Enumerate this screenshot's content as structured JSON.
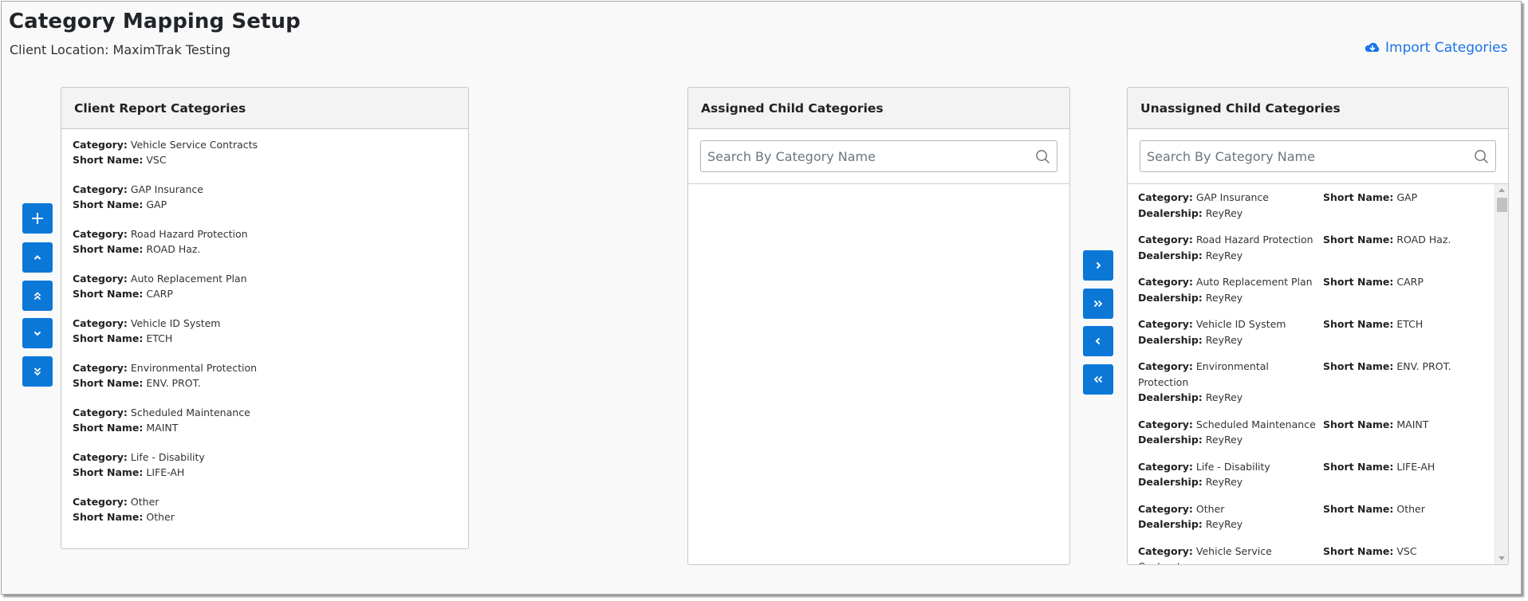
{
  "header": {
    "title": "Category Mapping Setup",
    "subtitle": "Client Location: MaximTrak Testing",
    "import_label": "Import Categories"
  },
  "labels": {
    "category": "Category:",
    "short_name": "Short Name:",
    "dealership": "Dealership:"
  },
  "client_report_categories": {
    "title": "Client Report Categories",
    "items": [
      {
        "category": "Vehicle Service Contracts",
        "short_name": "VSC"
      },
      {
        "category": "GAP Insurance",
        "short_name": "GAP"
      },
      {
        "category": "Road Hazard Protection",
        "short_name": "ROAD Haz."
      },
      {
        "category": "Auto Replacement Plan",
        "short_name": "CARP"
      },
      {
        "category": "Vehicle ID System",
        "short_name": "ETCH"
      },
      {
        "category": "Environmental Protection",
        "short_name": "ENV. PROT."
      },
      {
        "category": "Scheduled Maintenance",
        "short_name": "MAINT"
      },
      {
        "category": "Life - Disability",
        "short_name": "LIFE-AH"
      },
      {
        "category": "Other",
        "short_name": "Other"
      }
    ]
  },
  "order_buttons": [
    {
      "name": "add-category-button",
      "icon": "plus-icon"
    },
    {
      "name": "move-up-button",
      "icon": "chevron-up-icon"
    },
    {
      "name": "move-top-button",
      "icon": "double-chevron-up-icon"
    },
    {
      "name": "move-down-button",
      "icon": "chevron-down-icon"
    },
    {
      "name": "move-bottom-button",
      "icon": "double-chevron-down-icon"
    }
  ],
  "assigned_child_categories": {
    "title": "Assigned Child Categories",
    "search_placeholder": "Search By Category Name",
    "search_value": "",
    "items": []
  },
  "transfer_buttons": [
    {
      "name": "assign-selected-button",
      "icon": "chevron-right-icon"
    },
    {
      "name": "assign-all-button",
      "icon": "double-chevron-right-icon"
    },
    {
      "name": "unassign-selected-button",
      "icon": "chevron-left-icon"
    },
    {
      "name": "unassign-all-button",
      "icon": "double-chevron-left-icon"
    }
  ],
  "unassigned_child_categories": {
    "title": "Unassigned Child Categories",
    "search_placeholder": "Search By Category Name",
    "search_value": "",
    "items": [
      {
        "category": "GAP Insurance",
        "dealership": "ReyRey",
        "short_name": "GAP"
      },
      {
        "category": "Road Hazard Protection",
        "dealership": "ReyRey",
        "short_name": "ROAD Haz."
      },
      {
        "category": "Auto Replacement Plan",
        "dealership": "ReyRey",
        "short_name": "CARP"
      },
      {
        "category": "Vehicle ID System",
        "dealership": "ReyRey",
        "short_name": "ETCH"
      },
      {
        "category": "Environmental Protection",
        "dealership": "ReyRey",
        "short_name": "ENV. PROT."
      },
      {
        "category": "Scheduled Maintenance",
        "dealership": "ReyRey",
        "short_name": "MAINT"
      },
      {
        "category": "Life - Disability",
        "dealership": "ReyRey",
        "short_name": "LIFE-AH"
      },
      {
        "category": "Other",
        "dealership": "ReyRey",
        "short_name": "Other"
      },
      {
        "category": "Vehicle Service Contracts",
        "dealership": "",
        "short_name": "VSC"
      }
    ]
  },
  "colors": {
    "primary_button": "#0b78d8",
    "link": "#1a73e8"
  }
}
